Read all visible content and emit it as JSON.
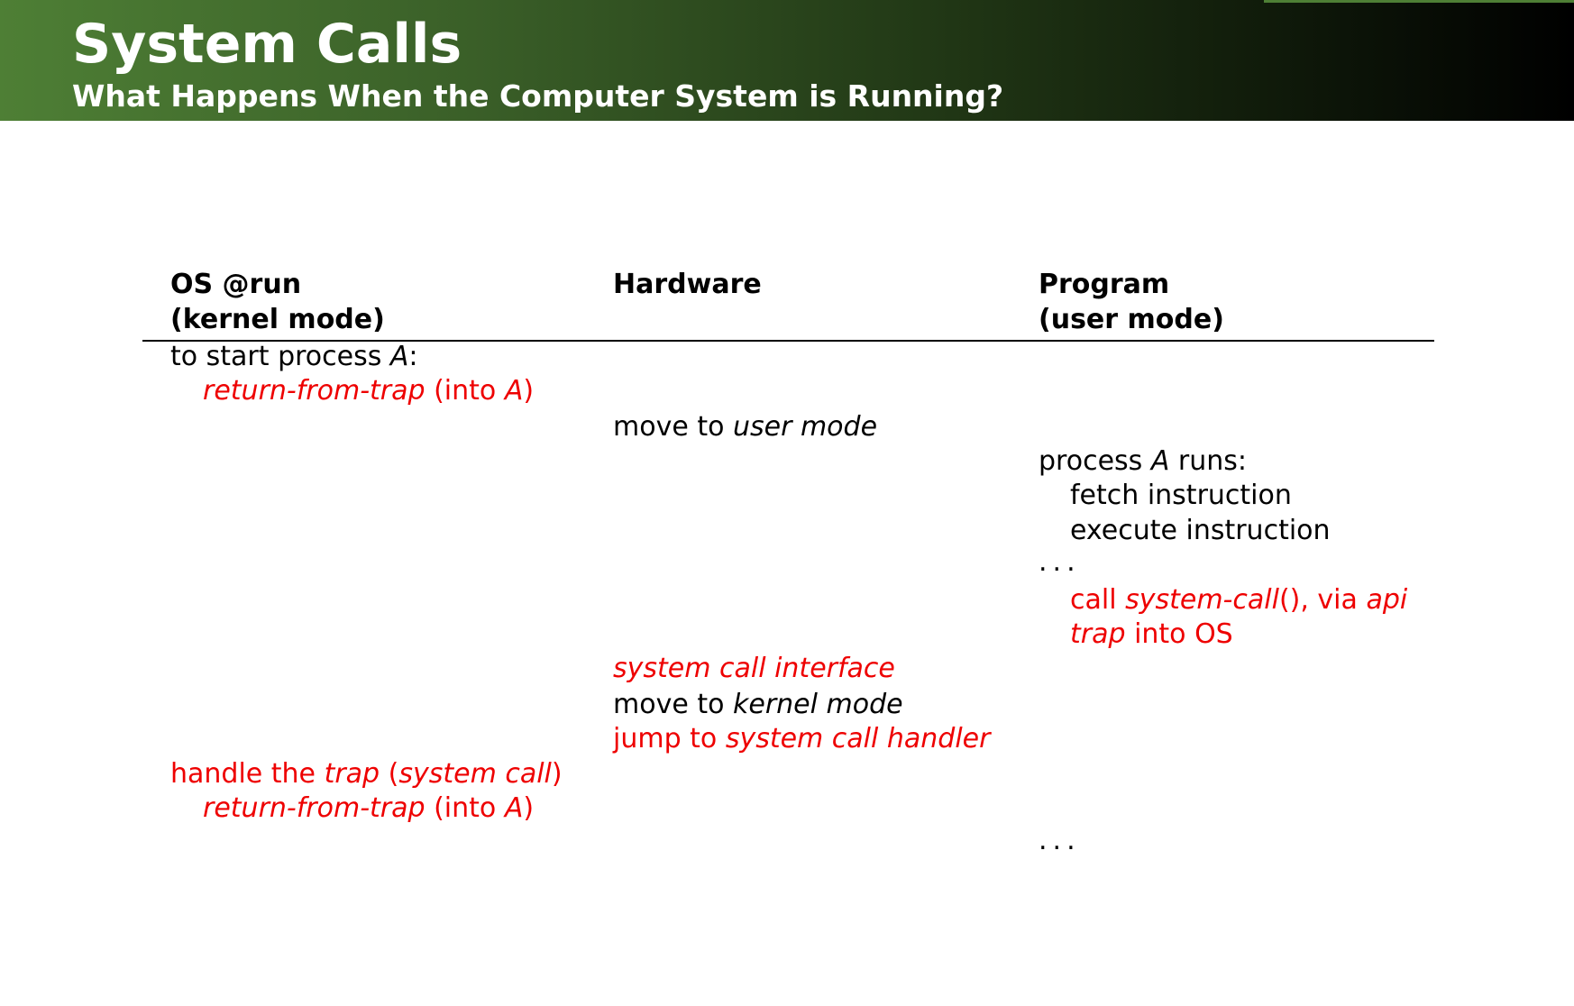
{
  "header": {
    "title": "System Calls",
    "subtitle": "What Happens When the Computer System is Running?"
  },
  "table": {
    "columns": {
      "os": {
        "line1": "OS @run",
        "line2": "(kernel mode)"
      },
      "hardware": {
        "line1": "Hardware"
      },
      "program": {
        "line1": "Program",
        "line2": "(user mode)"
      }
    },
    "os_start": {
      "prefix": "to start process ",
      "var": "A",
      "suffix": ":"
    },
    "os_return_1": {
      "italic": "return-from-trap",
      "mid": " (into ",
      "var": "A",
      "end": ")"
    },
    "hw_user_mode": {
      "text": "move to ",
      "italic": "user mode"
    },
    "prog_runs": {
      "prefix": "process ",
      "var": "A",
      "suffix": " runs:"
    },
    "prog_fetch": "fetch instruction",
    "prog_execute": "execute instruction",
    "prog_dots_1": "...",
    "prog_call": {
      "text1": "call ",
      "italic1": "system-call",
      "text2": "(), via ",
      "italic2": "api"
    },
    "prog_trap": {
      "italic": "trap",
      "text": " into OS"
    },
    "hw_interface": "system call interface",
    "hw_kernel_mode": {
      "text": "move to ",
      "italic": "kernel mode"
    },
    "hw_jump": {
      "text": "jump to ",
      "italic": "system call handler"
    },
    "os_handle": {
      "text1": "handle the ",
      "italic1": "trap",
      "text2": " (",
      "italic2": "system call",
      "text3": ")"
    },
    "os_return_2": {
      "italic": "return-from-trap",
      "mid": " (into ",
      "var": "A",
      "end": ")"
    },
    "prog_dots_2": "..."
  },
  "colors": {
    "header_gradient_start": "#4e7f35",
    "header_gradient_end": "#000000",
    "highlight": "#ee0000"
  }
}
